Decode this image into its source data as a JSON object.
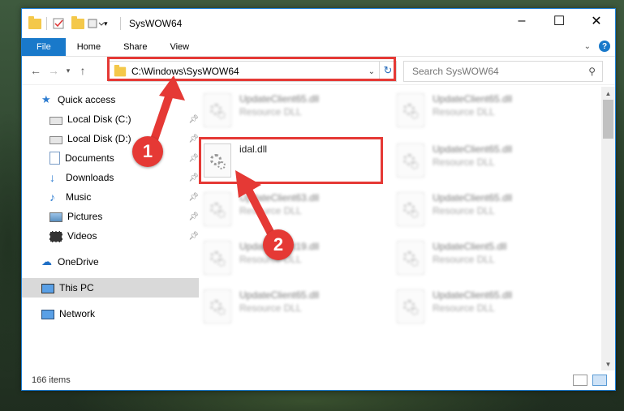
{
  "window": {
    "title": "SysWOW64"
  },
  "ribbon": {
    "tabs": [
      "File",
      "Home",
      "Share",
      "View"
    ],
    "help": "?"
  },
  "address": {
    "path": "C:\\Windows\\SysWOW64"
  },
  "search": {
    "placeholder": "Search SysWOW64"
  },
  "sidebar": {
    "items": [
      {
        "label": "Quick access"
      },
      {
        "label": "Local Disk (C:)"
      },
      {
        "label": "Local Disk (D:)"
      },
      {
        "label": "Documents"
      },
      {
        "label": "Downloads"
      },
      {
        "label": "Music"
      },
      {
        "label": "Pictures"
      },
      {
        "label": "Videos"
      },
      {
        "label": "OneDrive"
      },
      {
        "label": "This PC"
      },
      {
        "label": "Network"
      }
    ]
  },
  "files": [
    {
      "name": "UpdateClient65.dll",
      "type": "Resource DLL"
    },
    {
      "name": "UpdateClient65.dll",
      "type": "Resource DLL"
    },
    {
      "name": "idal.dll",
      "type": ""
    },
    {
      "name": "UpdateClient65.dll",
      "type": "Resource DLL"
    },
    {
      "name": "UpdateClient63.dll",
      "type": "Resource DLL"
    },
    {
      "name": "UpdateClient65.dll",
      "type": "Resource DLL"
    },
    {
      "name": "UpdateClient19.dll",
      "type": "Resource DLL"
    },
    {
      "name": "UpdateClient5.dll",
      "type": "Resource DLL"
    },
    {
      "name": "UpdateClient65.dll",
      "type": "Resource DLL"
    },
    {
      "name": "UpdateClient65.dll",
      "type": "Resource DLL"
    }
  ],
  "status": {
    "count": "166 items"
  },
  "markers": {
    "one": "1",
    "two": "2"
  },
  "colors": {
    "accent": "#1979ca",
    "highlight": "#e53935"
  }
}
